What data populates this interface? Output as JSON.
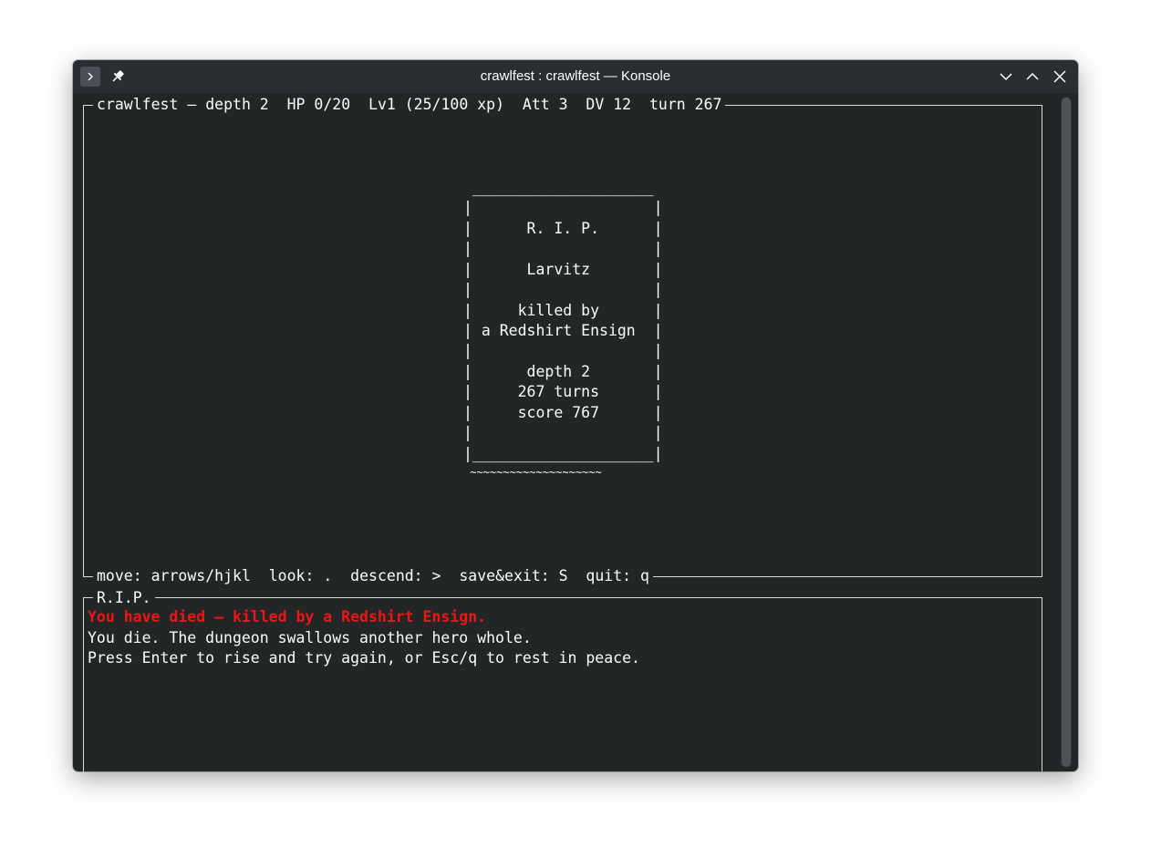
{
  "window": {
    "title": "crawlfest : crawlfest — Konsole"
  },
  "titlebar_icons": {
    "menu": "terminal-prompt-icon",
    "pin": "pin-icon",
    "minimize": "chevron-down-icon",
    "maximize": "chevron-up-icon",
    "close": "close-icon"
  },
  "status": {
    "header": "crawlfest — depth 2  HP 0/20  Lv1 (25/100 xp)  Att 3  DV 12  turn 267",
    "footer": "move: arrows/hjkl  look: .  descend: >  save&exit: S  quit: q"
  },
  "tombstone": {
    "lines": [
      " ____________________",
      "|                    |",
      "|      R. I. P.      |",
      "|                    |",
      "|      Larvitz       |",
      "|                    |",
      "|     killed by      |",
      "| a Redshirt Ensign  |",
      "|                    |",
      "|      depth 2       |",
      "|     267 turns      |",
      "|     score 767      |",
      "|                    |",
      "|____________________|",
      " ~~~~~~~~~~~~~~~~~~~~"
    ]
  },
  "log": {
    "title": "R.I.P.",
    "messages": [
      "You have died — killed by a Redshirt Ensign.",
      "You die. The dungeon swallows another hero whole.",
      "Press Enter to rise and try again, or Esc/q to rest in peace."
    ]
  },
  "colors": {
    "background": "#232627",
    "foreground": "#fcfcfc",
    "death_message": "#ed1515",
    "border": "#d9d9d9"
  }
}
